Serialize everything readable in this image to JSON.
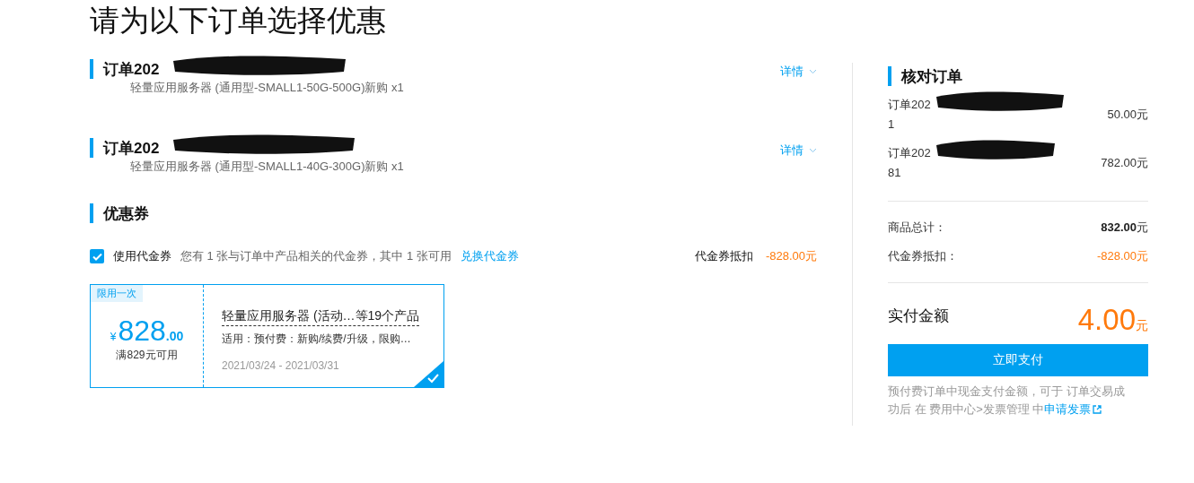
{
  "page_title": "请为以下订单选择优惠",
  "orders": [
    {
      "title": "订单202",
      "product": "轻量应用服务器 (通用型-SMALL1-50G-500G)新购 x1",
      "details": "详情"
    },
    {
      "title": "订单202",
      "product": "轻量应用服务器 (通用型-SMALL1-40G-300G)新购 x1",
      "details": "详情"
    }
  ],
  "coupons": {
    "heading": "优惠券",
    "use_voucher": {
      "label": "使用代金券",
      "checked": true
    },
    "info": "您有 1 张与订单中产品相关的代金券，其中 1 张可用",
    "exchange_link": "兑换代金券",
    "deduction_label": "代金券抵扣",
    "deduction_value": "-828.00元",
    "cards": [
      {
        "tag": "限用一次",
        "currency": "¥",
        "amount": "828",
        "decimals": ".00",
        "threshold": "满829元可用",
        "name": "轻量应用服务器 (活动…等19个产品",
        "scope": "适用：预付费：新购/续费/升级，限购…",
        "dates": "2021/03/24 - 2021/03/31",
        "selected": true
      }
    ]
  },
  "summary": {
    "heading": "核对订单",
    "orders": [
      {
        "line1": "订单202",
        "line2": "1",
        "amount": "50.00元"
      },
      {
        "line1": "订单202",
        "line2": "81",
        "amount": "782.00元"
      }
    ],
    "total_label": "商品总计：",
    "total_value": "832.00",
    "total_unit": "元",
    "deduction_label": "代金券抵扣：",
    "deduction_value": "-828.00元",
    "pay_label": "实付金额",
    "pay_value": "4.00",
    "pay_unit": "元",
    "pay_button": "立即支付",
    "note": "预付费订单中现金支付金额，可于 订单交易成功后 在 费用中心>发票管理 中",
    "note_link": "申请发票"
  }
}
